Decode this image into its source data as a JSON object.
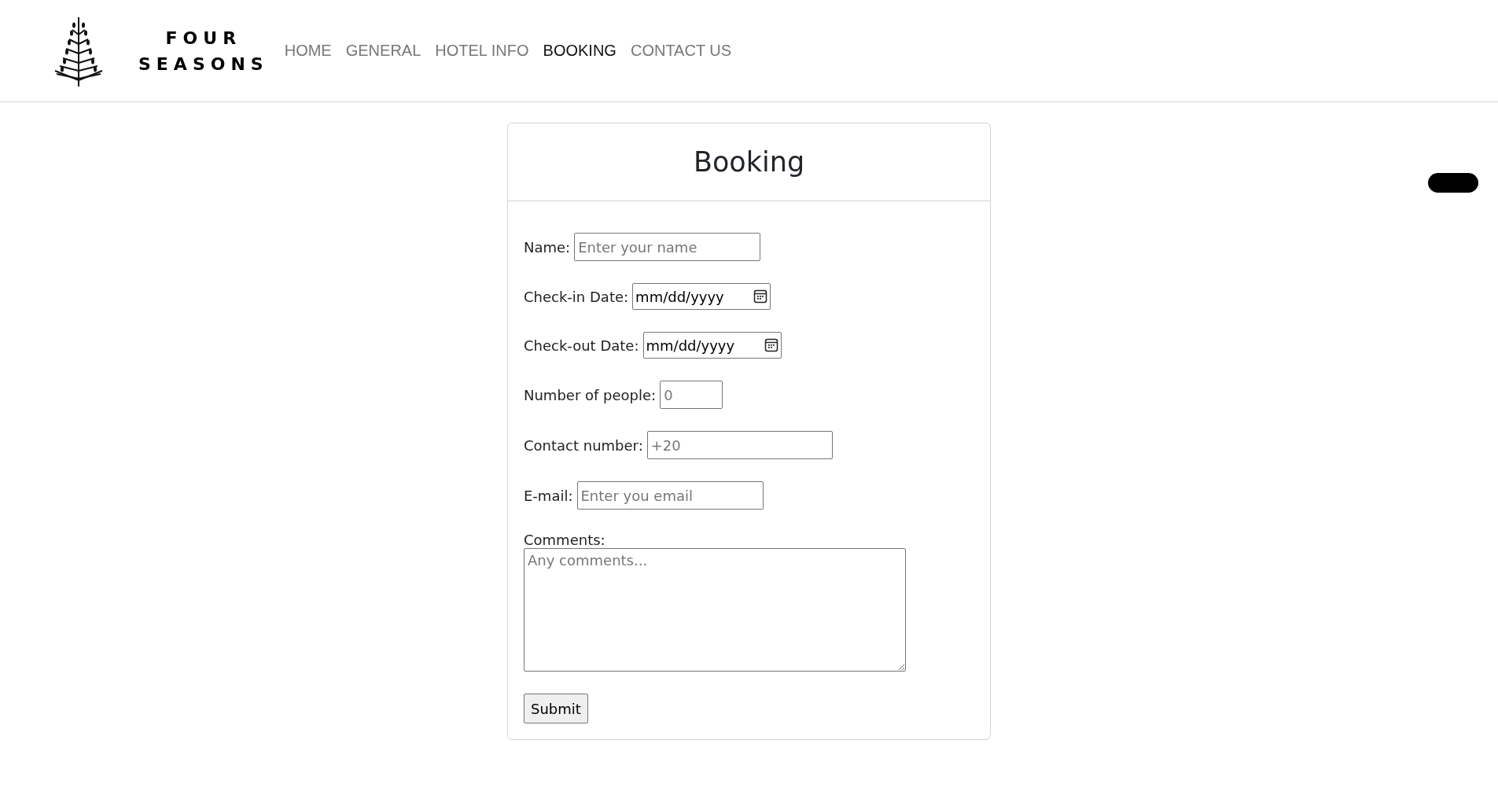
{
  "brand": {
    "line_1": "FOUR",
    "line_2": "SEASONS"
  },
  "nav": [
    {
      "label": "HOME",
      "selected": false
    },
    {
      "label": "GENERAL",
      "selected": false
    },
    {
      "label": "HOTEL INFO",
      "selected": false
    },
    {
      "label": "BOOKING",
      "selected": true
    },
    {
      "label": "CONTACT US",
      "selected": false
    }
  ],
  "form": {
    "title": "Booking",
    "fields": [
      {
        "kind": "text",
        "label": "Name:",
        "placeholder": "Enter your name"
      },
      {
        "kind": "date",
        "label": "Check-in Date:",
        "value": "mm/dd/yyyy"
      },
      {
        "kind": "date",
        "label": "Check-out Date:",
        "value": "mm/dd/yyyy"
      },
      {
        "kind": "number",
        "label": "Number of people:",
        "placeholder": "0"
      },
      {
        "kind": "text",
        "label": "Contact number:",
        "placeholder": "+20"
      },
      {
        "kind": "text",
        "label": "E-mail:",
        "placeholder": "Enter you email"
      },
      {
        "kind": "textarea",
        "label": "Comments:",
        "placeholder": "Any comments..."
      }
    ],
    "submit": "Submit"
  }
}
